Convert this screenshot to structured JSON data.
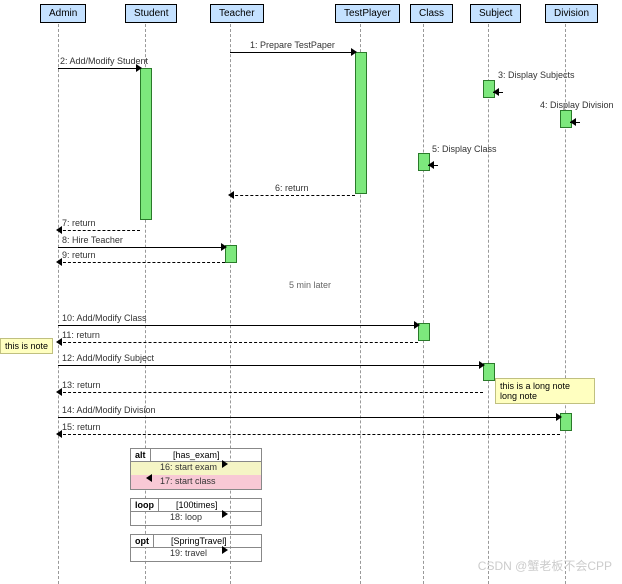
{
  "chart_data": {
    "type": "sequence_diagram",
    "participants": [
      "Admin",
      "Student",
      "Teacher",
      "TestPlayer",
      "Class",
      "Subject",
      "Division"
    ],
    "messages": [
      {
        "n": 1,
        "from": "Teacher",
        "to": "TestPlayer",
        "label": "Prepare TestPaper",
        "return": false
      },
      {
        "n": 2,
        "from": "Admin",
        "to": "Student",
        "label": "Add/Modify Student",
        "return": false
      },
      {
        "n": 3,
        "from": "Subject",
        "to": "Subject",
        "label": "Display Subjects",
        "return": false,
        "self": true
      },
      {
        "n": 4,
        "from": "Division",
        "to": "Division",
        "label": "Display Division",
        "return": false,
        "self": true
      },
      {
        "n": 5,
        "from": "Class",
        "to": "Class",
        "label": "Display Class",
        "return": false,
        "self": true
      },
      {
        "n": 6,
        "from": "TestPlayer",
        "to": "Teacher",
        "label": "return",
        "return": true
      },
      {
        "n": 7,
        "from": "Student",
        "to": "Admin",
        "label": "return",
        "return": true
      },
      {
        "n": 8,
        "from": "Admin",
        "to": "Teacher",
        "label": "Hire Teacher",
        "return": false
      },
      {
        "n": 9,
        "from": "Teacher",
        "to": "Admin",
        "label": "return",
        "return": true
      },
      {
        "n": 10,
        "from": "Admin",
        "to": "Class",
        "label": "Add/Modify Class",
        "return": false
      },
      {
        "n": 11,
        "from": "Class",
        "to": "Admin",
        "label": "return",
        "return": true
      },
      {
        "n": 12,
        "from": "Admin",
        "to": "Subject",
        "label": "Add/Modify Subject",
        "return": false
      },
      {
        "n": 13,
        "from": "Subject",
        "to": "Admin",
        "label": "return",
        "return": true
      },
      {
        "n": 14,
        "from": "Admin",
        "to": "Division",
        "label": "Add/Modify Division",
        "return": false
      },
      {
        "n": 15,
        "from": "Division",
        "to": "Admin",
        "label": "return",
        "return": true
      },
      {
        "n": 16,
        "from": "Student",
        "to": "Teacher",
        "label": "start exam",
        "fragment": "alt"
      },
      {
        "n": 17,
        "from": "Teacher",
        "to": "Student",
        "label": "start class",
        "fragment": "alt"
      },
      {
        "n": 18,
        "from": "Student",
        "to": "Teacher",
        "label": "loop",
        "fragment": "loop"
      },
      {
        "n": 19,
        "from": "Student",
        "to": "Teacher",
        "label": "travel",
        "fragment": "opt"
      }
    ],
    "fragments": [
      {
        "type": "alt",
        "guard": "[has_exam]"
      },
      {
        "type": "loop",
        "guard": "[100times]"
      },
      {
        "type": "opt",
        "guard": "[SpringTravel]"
      }
    ],
    "notes": [
      {
        "text": "this is note",
        "side": "left",
        "attached_to": 11
      },
      {
        "text": "this is a long note\nlong note",
        "side": "right",
        "attached_to": 13
      }
    ],
    "gap_text": "5 min later"
  },
  "labels": {
    "actors": {
      "admin": "Admin",
      "student": "Student",
      "teacher": "Teacher",
      "testplayer": "TestPlayer",
      "class": "Class",
      "subject": "Subject",
      "division": "Division"
    },
    "m1": "1: Prepare TestPaper",
    "m2": "2: Add/Modify Student",
    "m3": "3: Display Subjects",
    "m4": "4: Display Division",
    "m5": "5: Display Class",
    "m6": "6: return",
    "m7": "7: return",
    "m8": "8: Hire Teacher",
    "m9": "9: return",
    "m10": "10: Add/Modify Class",
    "m11": "11: return",
    "m12": "12: Add/Modify Subject",
    "m13": "13: return",
    "m14": "14: Add/Modify Division",
    "m15": "15: return",
    "m16": "16: start exam",
    "m17": "17: start class",
    "m18": "18: loop",
    "m19": "19: travel",
    "gap": "5 min later",
    "note1": "this is note",
    "note2": "this is a long note\nlong note",
    "alt": "alt",
    "alt_guard": "[has_exam]",
    "loop": "loop",
    "loop_guard": "[100times]",
    "opt": "opt",
    "opt_guard": "[SpringTravel]"
  },
  "watermark": "CSDN @蟹老板不会CPP"
}
